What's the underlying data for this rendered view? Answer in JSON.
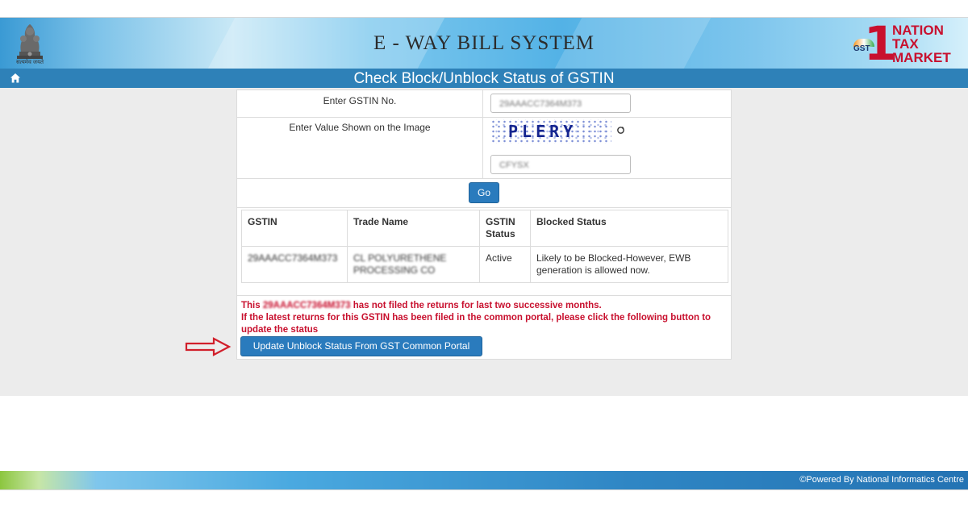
{
  "header": {
    "emblem_caption": "सत्यमेव जयते",
    "title": "E - WAY BILL SYSTEM",
    "logo": {
      "badge": "1",
      "gst": "GST",
      "line1": "NATION",
      "line2": "TAX",
      "line3": "MARKET"
    }
  },
  "nav": {
    "home_icon": "home-icon",
    "page_title": "Check Block/Unblock Status of GSTIN"
  },
  "form": {
    "gstin_label": "Enter GSTIN No.",
    "gstin_value": "29AAACC7364M373",
    "captcha_label": "Enter Value Shown on the Image",
    "captcha_image_text": "PLERY",
    "captcha_value": "CFYSX",
    "go_label": "Go"
  },
  "table": {
    "headers": [
      "GSTIN",
      "Trade Name",
      "GSTIN Status",
      "Blocked Status"
    ],
    "row": {
      "gstin": "29AAACC7364M373",
      "trade_name": "CL POLYURETHENE PROCESSING CO",
      "status": "Active",
      "blocked_status": "Likely to be Blocked-However, EWB generation is allowed now."
    }
  },
  "warning": {
    "prefix": "This",
    "gstin": "29AAACC7364M373",
    "line1_suffix": "has not filed the returns for last two successive months.",
    "line2": "If the latest returns for this GSTIN has been filed in the common portal, please click the following button to update the status"
  },
  "update_button": "Update Unblock Status From GST Common Portal",
  "footer": {
    "text": "©Powered By National Informatics Centre"
  },
  "colors": {
    "nav": "#2e81b8",
    "button": "#2a7bbd",
    "warning": "#c8102e",
    "content_bg": "#ececec"
  }
}
